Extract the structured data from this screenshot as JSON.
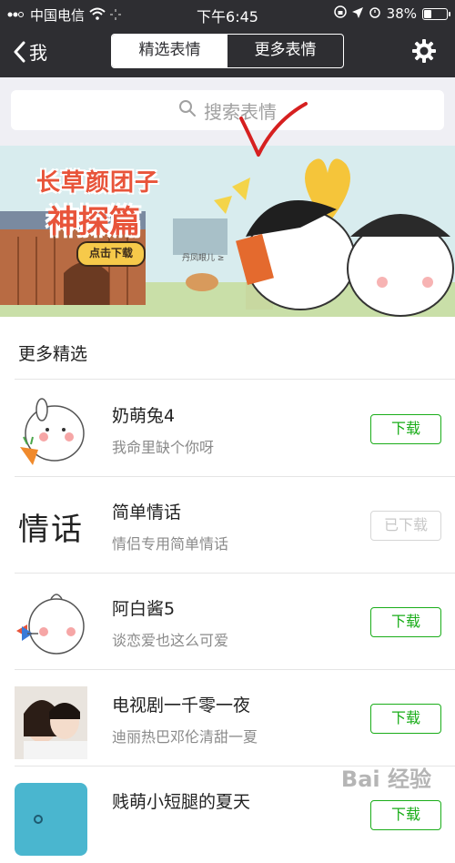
{
  "status_bar": {
    "carrier": "中国电信",
    "time": "下午6:45",
    "battery_percent": "38%",
    "battery_level": 0.38
  },
  "nav": {
    "back_label": "我",
    "tabs": [
      {
        "label": "精选表情",
        "active": true
      },
      {
        "label": "更多表情",
        "active": false
      }
    ]
  },
  "search": {
    "placeholder": "搜索表情"
  },
  "banner": {
    "title": "长草颜团子",
    "subtitle": "神探篇",
    "button_label": "点击下载",
    "small_text": "丹凤眼儿 ≥"
  },
  "section": {
    "title": "更多精选"
  },
  "items": [
    {
      "name": "奶萌兔4",
      "desc": "我命里缺个你呀",
      "action": "下载",
      "downloaded": false
    },
    {
      "name": "简单情话",
      "desc": "情侣专用简单情话",
      "action": "已下载",
      "downloaded": true,
      "thumb_text": "情话"
    },
    {
      "name": "阿白酱5",
      "desc": "谈恋爱也这么可爱",
      "action": "下载",
      "downloaded": false
    },
    {
      "name": "电视剧一千零一夜",
      "desc": "迪丽热巴邓伦清甜一夏",
      "action": "下载",
      "downloaded": false
    },
    {
      "name": "贱萌小短腿的夏天",
      "desc": "",
      "action": "下载",
      "downloaded": false
    }
  ],
  "watermark": "Bai 经验",
  "colors": {
    "nav_bg": "#2e2e32",
    "accent_green": "#1aad19",
    "search_bg": "#efeff4",
    "banner_red": "#e8543a"
  }
}
